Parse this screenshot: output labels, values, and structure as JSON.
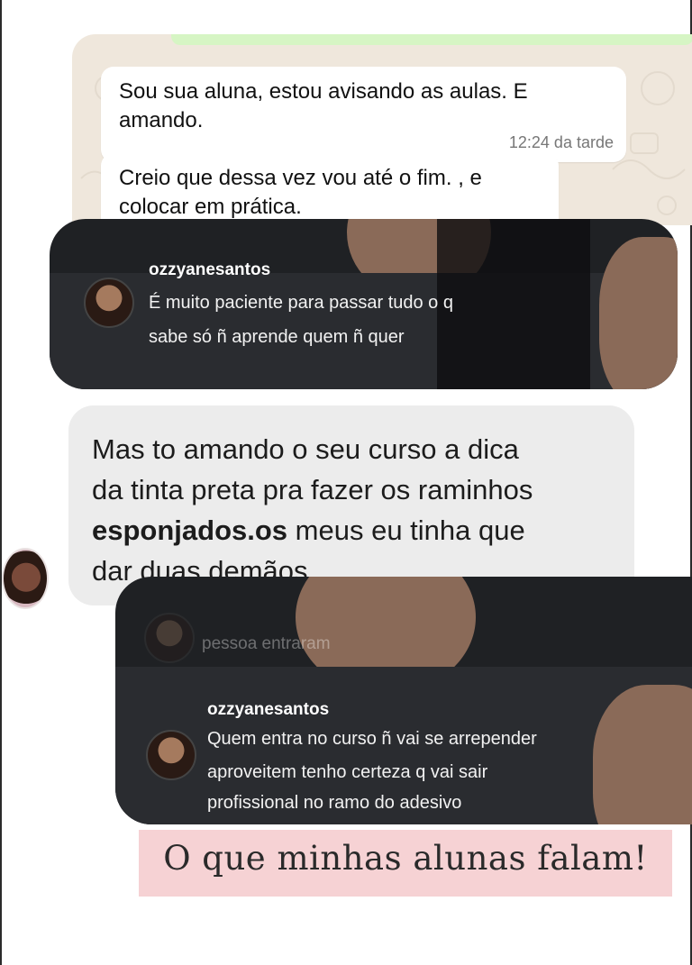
{
  "whatsapp": {
    "message1": {
      "text": "Sou sua aluna, estou avisando as aulas. E amando.",
      "time": "12:24 da tarde"
    },
    "message2": {
      "text": "Creio que dessa vez vou até o fim. , e colocar em prática."
    }
  },
  "comment1": {
    "username": "ozzyanesantos",
    "text_line1": "É muito paciente para passar tudo o q",
    "text_line2": "sabe só ñ aprende quem ñ quer"
  },
  "grey_message": {
    "line1": "Mas to amando o seu curso a dica",
    "line2": "da tinta preta pra fazer os raminhos",
    "bold": "esponjados.os",
    "line3_rest": " meus eu tinha que",
    "line4": "dar duas demãos"
  },
  "comment2": {
    "faint_text": "pessoa entraram",
    "username": "ozzyanesantos",
    "text_line1": "Quem entra no curso ñ vai se arrepender",
    "text_line2": "aproveitem tenho certeza q vai sair",
    "text_line3": "profissional no ramo do adesivo"
  },
  "banner": {
    "text": "O que minhas alunas falam!"
  }
}
